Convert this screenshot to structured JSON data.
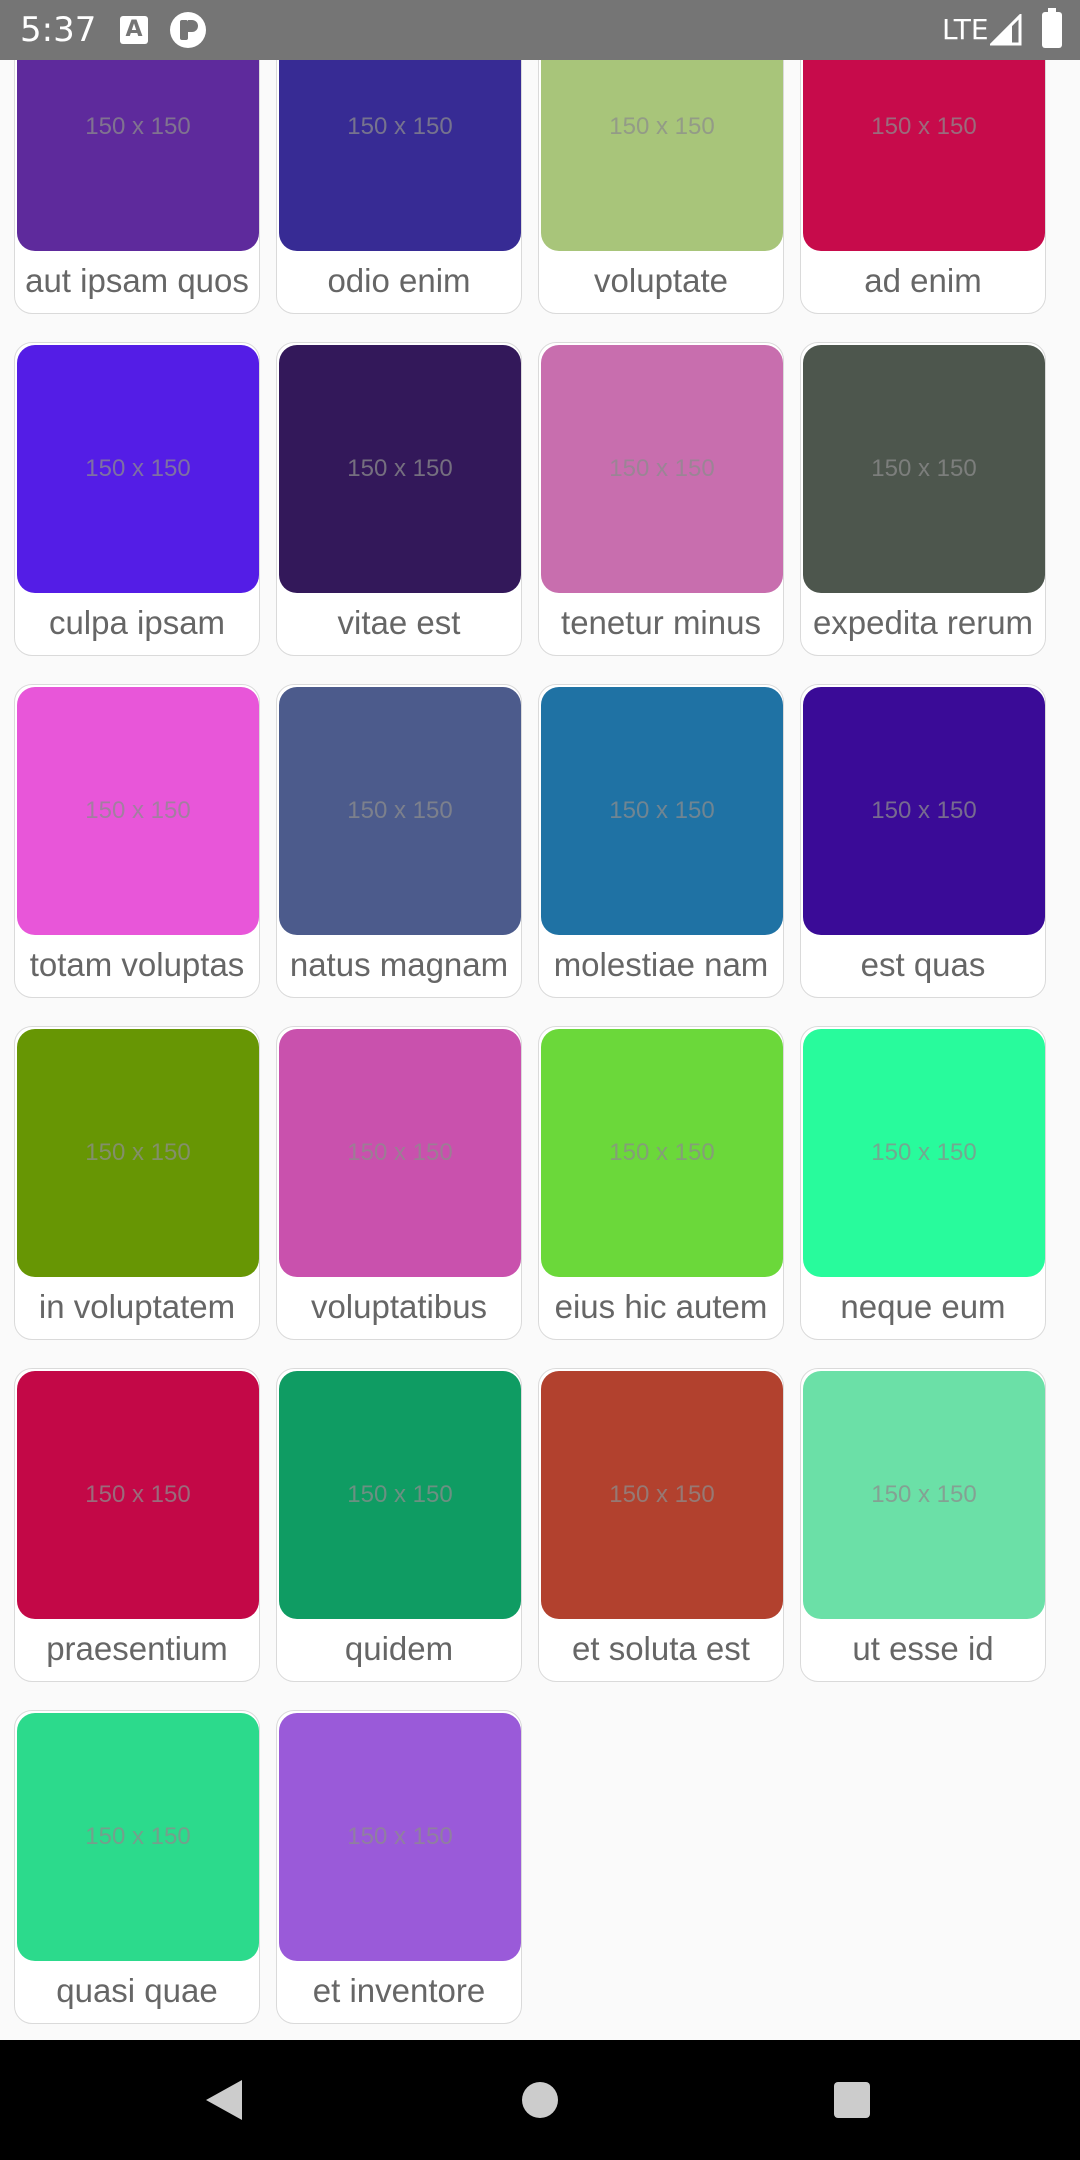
{
  "status_bar": {
    "time": "5:37",
    "network": "LTE",
    "icons": [
      "a-keyboard-icon",
      "p-app-icon",
      "signal-icon",
      "battery-icon"
    ]
  },
  "placeholder_text": "150 x 150",
  "cards": [
    {
      "label": "aut ipsam quos",
      "color": "#5e2a9c"
    },
    {
      "label": "odio enim",
      "color": "#372b94"
    },
    {
      "label": "voluptate",
      "color": "#a8c57a"
    },
    {
      "label": "ad enim",
      "color": "#c70b4b"
    },
    {
      "label": "culpa ipsam",
      "color": "#541de6"
    },
    {
      "label": "vitae est",
      "color": "#33185a"
    },
    {
      "label": "tenetur minus",
      "color": "#c86eae"
    },
    {
      "label": "expedita rerum",
      "color": "#4d564d"
    },
    {
      "label": "totam voluptas",
      "color": "#e856d9"
    },
    {
      "label": "natus magnam",
      "color": "#4c5b8c"
    },
    {
      "label": "molestiae nam",
      "color": "#1f72a4"
    },
    {
      "label": "est quas",
      "color": "#3a0b97"
    },
    {
      "label": "in voluptatem",
      "color": "#679604"
    },
    {
      "label": "voluptatibus",
      "color": "#c951ad"
    },
    {
      "label": "eius hic autem",
      "color": "#6bd83a"
    },
    {
      "label": "neque eum",
      "color": "#28fb9c"
    },
    {
      "label": "praesentium",
      "color": "#c30847"
    },
    {
      "label": "quidem",
      "color": "#0f9c63"
    },
    {
      "label": "et soluta est",
      "color": "#b2412e"
    },
    {
      "label": "ut esse id",
      "color": "#6be0a7"
    },
    {
      "label": "quasi quae",
      "color": "#2cda8c"
    },
    {
      "label": "et inventore",
      "color": "#9a5ad9"
    }
  ]
}
